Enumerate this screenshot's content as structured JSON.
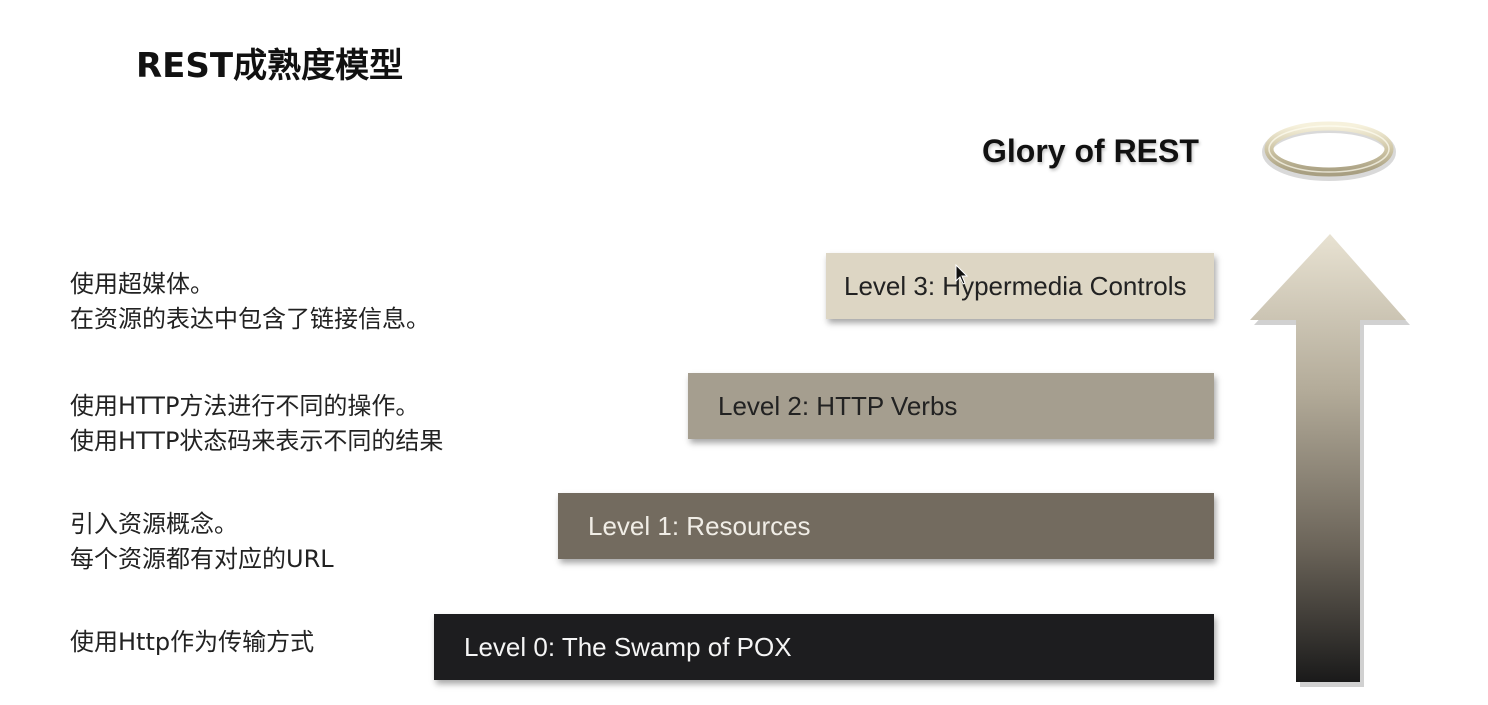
{
  "title": "REST成熟度模型",
  "glory": "Glory of REST",
  "descriptions": {
    "level3": [
      "使用超媒体。",
      "在资源的表达中包含了链接信息。"
    ],
    "level2": [
      "使用HTTP方法进行不同的操作。",
      "使用HTTP状态码来表示不同的结果"
    ],
    "level1": [
      "引入资源概念。",
      "每个资源都有对应的URL"
    ],
    "level0": [
      "使用Http作为传输方式"
    ]
  },
  "levels": {
    "level3": "Level 3: Hypermedia Controls",
    "level2": "Level 2: HTTP Verbs",
    "level1": "Level 1: Resources",
    "level0": "Level 0: The Swamp of POX"
  },
  "colors": {
    "level3": "#ddd6c4",
    "level2": "#a59e8f",
    "level1": "#736b5f",
    "level0": "#1d1d1f"
  },
  "icons": {
    "halo": "halo-icon",
    "arrow": "up-arrow-icon",
    "cursor": "mouse-cursor-icon"
  }
}
